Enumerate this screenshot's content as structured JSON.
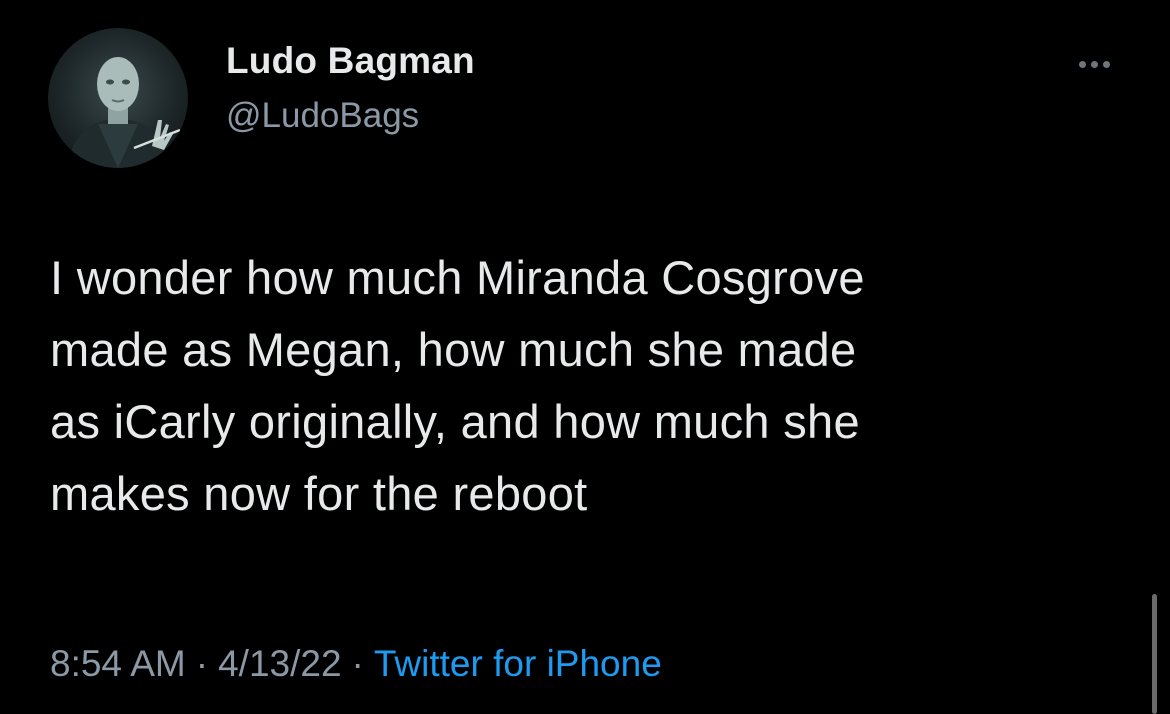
{
  "tweet": {
    "display_name": "Ludo Bagman",
    "handle": "@LudoBags",
    "text": "I wonder how much Miranda Cosgrove\nmade as Megan, how much she made\nas iCarly originally, and how much she\nmakes now for the reboot",
    "time": "8:54 AM",
    "date": "4/13/22",
    "separator": "·",
    "source": "Twitter for iPhone",
    "avatar_icon": "profile-photo",
    "more_icon": "more-dots-icon"
  },
  "colors": {
    "background": "#000000",
    "primary_text": "#e7e9ea",
    "secondary_text": "#8b98a5",
    "link": "#1d9bf0"
  }
}
